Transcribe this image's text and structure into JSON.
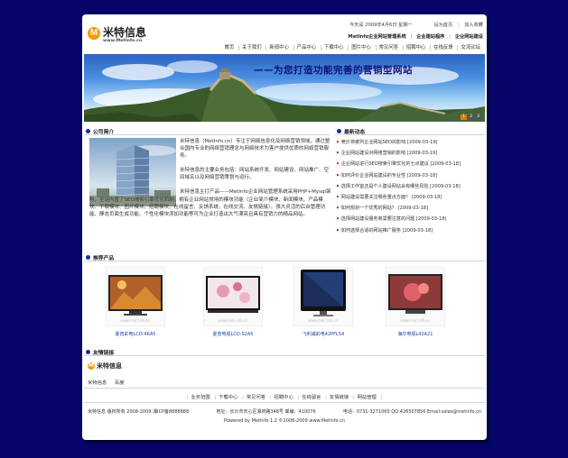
{
  "topbar": {
    "date": "今天是 2009年4月6日 星期一",
    "set_home": "设为首页",
    "add_favorite": "加入收藏"
  },
  "logo": {
    "badge": "M",
    "name": "米特信息",
    "url": "www.MetInfo.cn"
  },
  "sub_links": [
    "MetInfo企业网站管理系统",
    "企业建站程序",
    "企业网站建设"
  ],
  "nav": [
    "首页",
    "关于我们",
    "新闻中心",
    "产品中心",
    "下载中心",
    "图片中心",
    "常见问答",
    "招聘中心",
    "在线反馈",
    "交流论坛"
  ],
  "banner": {
    "slogan": "——为您打造功能完善的营销型网站",
    "slides": [
      "1",
      "2",
      "3"
    ]
  },
  "company": {
    "title": "公司简介",
    "paragraphs": [
      "米特信息（MetInfo.cn）专注于网络信息化及网络营销领域，通过整合国内专业的网络营销理念与网络技术为客户提供优质的网络营销服务。",
      "米特信息的主要业务包括：网站系统开发、网站建设、网站推广、空间域名以及网络营销策划与运行。",
      "米特信息主打产品——MetInfo企业网站管理系统采用PHP+Mysql架构，全站内置了SEO搜索引擎优化机制，拥有企业网站常用的模块功能（企业简介模块、新闻模块、产品模块、下载模块、图片模块、招聘模块、在线留言、反馈系统、在线交流、友情链接）。强大灵活的后台管理功能、静态页面生成功能、个性化模块添加功能等可为企业打造出大气漂亮且具有营销力的精品网站。"
    ]
  },
  "news": {
    "title": "最新动态",
    "items": [
      "竞价将被列企业网站SEO的影响 [2009-03-19]",
      "企业网站建设对网络营销的影响 [2009-03-19]",
      "企业网站进行SEO搜索引擎优化的七点建议 [2009-03-18]",
      "如何评价企业网站建设的专业性 [2009-03-18]",
      "选择工作室还是个人建设网站会有哪些风险 [2009-03-18]",
      "网站建设需要关注哪些重点方面？ [2009-03-18]",
      "如何规划一个优秀的网站？ [2009-03-18]",
      "选择网站建设服务商需要注意的问题 [2009-03-18]",
      "如何选择合适的网站推广服务 [2009-03-18]"
    ]
  },
  "products": {
    "title": "推荐产品",
    "items": [
      {
        "name": "夏普彩电LCD-46A5",
        "watermark": "www.met.info.cn"
      },
      {
        "name": "夏普电视LCD-52A5",
        "watermark": "www.met.info.cn"
      },
      {
        "name": "飞利浦彩电42PFL54",
        "watermark": "www.met.info.cn"
      },
      {
        "name": "海尔电视L42A21",
        "watermark": "www.met.info.cn"
      }
    ]
  },
  "friend_links": {
    "title": "友情链接",
    "logo_badge": "M",
    "logo_name": "米特信息",
    "links": [
      "米特信息",
      "百度"
    ]
  },
  "footer": {
    "nav": [
      "业务范围",
      "下载中心",
      "常见问答",
      "招聘中心",
      "在线留言",
      "友情链接",
      "网站管理"
    ],
    "copyright": "米特信息  版权所有 2008-2009 湘ICP备8888888",
    "address": "地址：长沙市天心区湘府路348号 邮编：410076",
    "contact": "电话：0731-3271060 QQ:426507856 Email:sales@metinfo.cn",
    "powered": "Powered by MetInfo 1.2 ©2008-2009 www.MetInfo.cn"
  },
  "colors": {
    "page_background": "#06066a",
    "accent_orange": "#f29a00",
    "link_blue": "#1a3fa0",
    "bullet_blue": "#1c2c9c"
  }
}
